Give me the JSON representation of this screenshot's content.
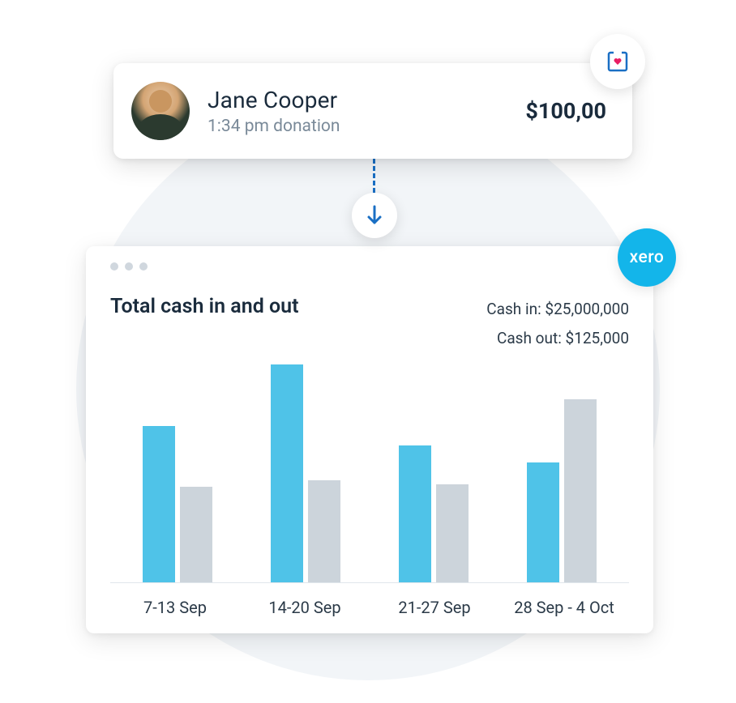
{
  "donation": {
    "name": "Jane Cooper",
    "meta": "1:34 pm donation",
    "amount": "$100,00"
  },
  "chart": {
    "title": "Total cash in and out",
    "cash_in_label": "Cash in: $25,000,000",
    "cash_out_label": "Cash out: $125,000"
  },
  "badges": {
    "xero": "xero"
  },
  "chart_data": {
    "type": "bar",
    "title": "Total cash in and out",
    "categories": [
      "7-13 Sep",
      "14-20 Sep",
      "21-27 Sep",
      "28 Sep - 4 Oct"
    ],
    "series": [
      {
        "name": "Cash in",
        "color": "#4fc3e8",
        "values": [
          72,
          100,
          63,
          55
        ]
      },
      {
        "name": "Cash out",
        "color": "#ccd4db",
        "values": [
          44,
          47,
          45,
          84
        ]
      }
    ],
    "ylim": [
      0,
      100
    ],
    "note": "Values are relative bar heights (percent of max); absolute dollar values not labeled per bar.",
    "summary": {
      "cash_in_total": "$25,000,000",
      "cash_out_total": "$125,000"
    }
  }
}
